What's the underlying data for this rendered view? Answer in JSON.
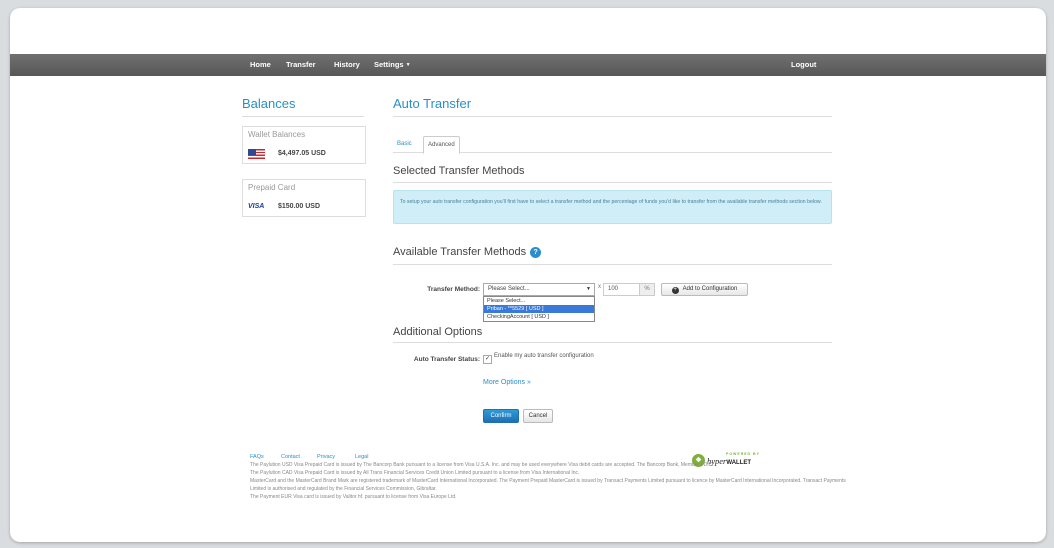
{
  "nav": {
    "home": "Home",
    "transfer": "Transfer",
    "history": "History",
    "settings": "Settings",
    "logout": "Logout"
  },
  "sidebar": {
    "title": "Balances",
    "wallet": {
      "title": "Wallet Balances",
      "amount": "$4,497.05 USD",
      "flag_icon": "us-flag-icon"
    },
    "prepaid": {
      "title": "Prepaid Card",
      "amount": "$150.00 USD",
      "logo": "VISA"
    }
  },
  "main": {
    "title": "Auto Transfer",
    "tabs": [
      {
        "label": "Basic",
        "active": false
      },
      {
        "label": "Advanced",
        "active": true
      }
    ],
    "selected_title": "Selected Transfer Methods",
    "info_text": "To setup your auto transfer configuration you'll first have to select a transfer method and the percentage of funds you'd like to transfer from the available transfer methods section below.",
    "available_title": "Available Transfer Methods",
    "help_icon_label": "?",
    "transfer_method_label": "Transfer Method:",
    "select_value": "Please Select...",
    "dropdown_options": [
      "Please Select...",
      "Priban - **5529 [ USD ]",
      "CheckingAccount [ USD ]"
    ],
    "dropdown_selected_index": 1,
    "x_label": "x",
    "percent_value": "100",
    "percent_unit": "%",
    "add_button_icon": "+",
    "add_button": "Add to Configuration",
    "additional_title": "Additional Options",
    "auto_status_label": "Auto Transfer Status:",
    "auto_status_checked": true,
    "auto_status_text": "Enable my auto transfer configuration",
    "more_options": "More Options »",
    "confirm": "Confirm",
    "cancel": "Cancel"
  },
  "footer": {
    "links": [
      "FAQs",
      "Contact",
      "Privacy",
      "Legal"
    ],
    "powered_by": "POWERED BY",
    "brand_main": "hyper",
    "brand_suffix": "WALLET",
    "legal": [
      "The Paylution USD Visa Prepaid Card is issued by The Bancorp Bank pursuant to a license from Visa U.S.A. Inc. and may be used everywhere Visa debit cards are accepted. The Bancorp Bank, Member FDIC.",
      "The Paylution CAD Visa Prepaid Card is issued by All Trans Financial Services Credit Union Limited pursuant to a license from Visa International Inc.",
      "MasterCard and the MasterCard Brand Mark are registered trademark of MasterCard International Incorporated. The Payment Prepaid MasterCard is issued by Transact Payments Limited pursuant to licence by MasterCard International Incorporated. Transact Payments Limited is authorised and regulated by the Financial Services Commission, Gibraltar.",
      "The Payment EUR Visa card is issued by Valitor hf. pursuant to license from Visa Europe Ltd."
    ]
  },
  "colors": {
    "accent": "#2a8fc9",
    "nav": "#5f5f5f",
    "info_bg": "#cfeef8",
    "selected_option": "#3879d9"
  }
}
